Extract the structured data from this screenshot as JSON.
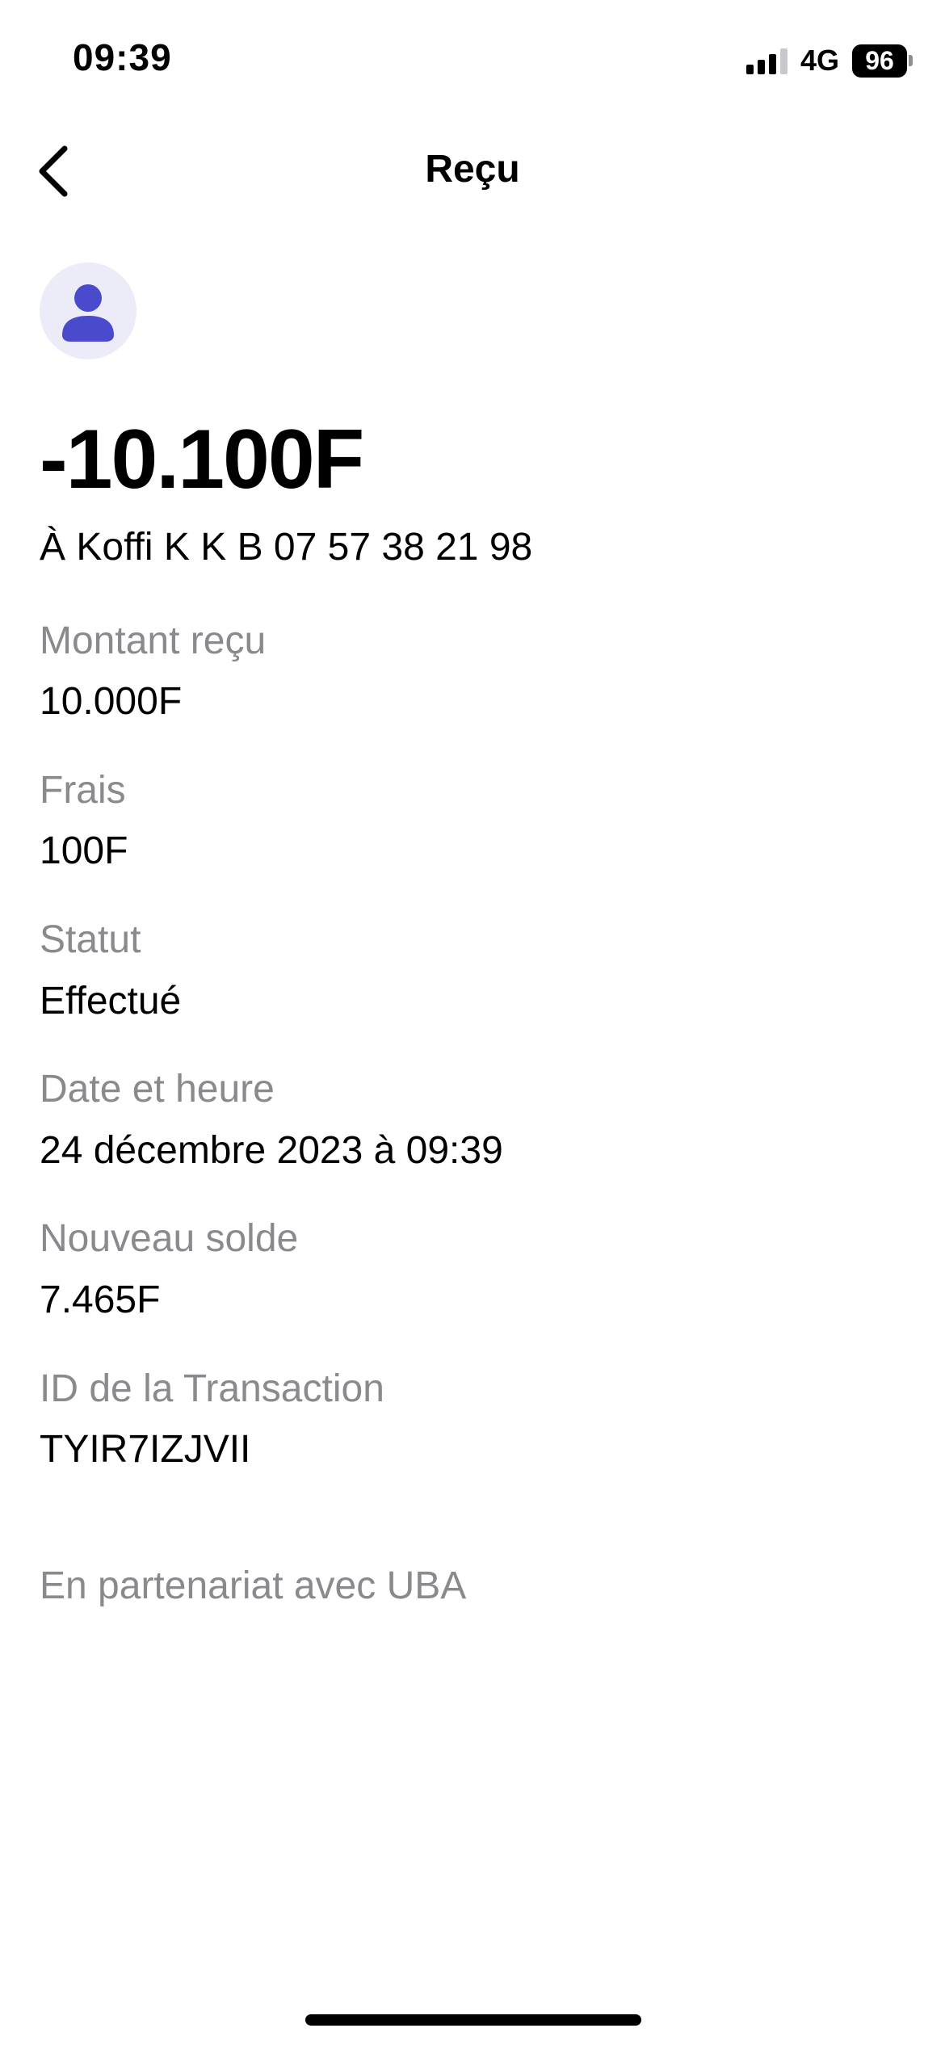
{
  "status_bar": {
    "time": "09:39",
    "network": "4G",
    "battery": "96",
    "signal_bars_active": 3,
    "signal_bars_total": 4
  },
  "nav": {
    "title": "Reçu",
    "back_icon": "chevron-left-icon"
  },
  "avatar": {
    "icon": "person-icon",
    "accent_color": "#4a4acd",
    "background_color": "#ececf8"
  },
  "transaction": {
    "amount": "-10.100F",
    "recipient": "À Koffi K K B 07 57 38 21 98"
  },
  "details": [
    {
      "label": "Montant reçu",
      "value": "10.000F"
    },
    {
      "label": "Frais",
      "value": "100F"
    },
    {
      "label": "Statut",
      "value": "Effectué"
    },
    {
      "label": "Date et heure",
      "value": "24 décembre 2023 à 09:39"
    },
    {
      "label": "Nouveau solde",
      "value": "7.465F"
    },
    {
      "label": "ID de la Transaction",
      "value": "TYIR7IZJVII"
    }
  ],
  "footer": {
    "partner": "En partenariat avec UBA"
  }
}
